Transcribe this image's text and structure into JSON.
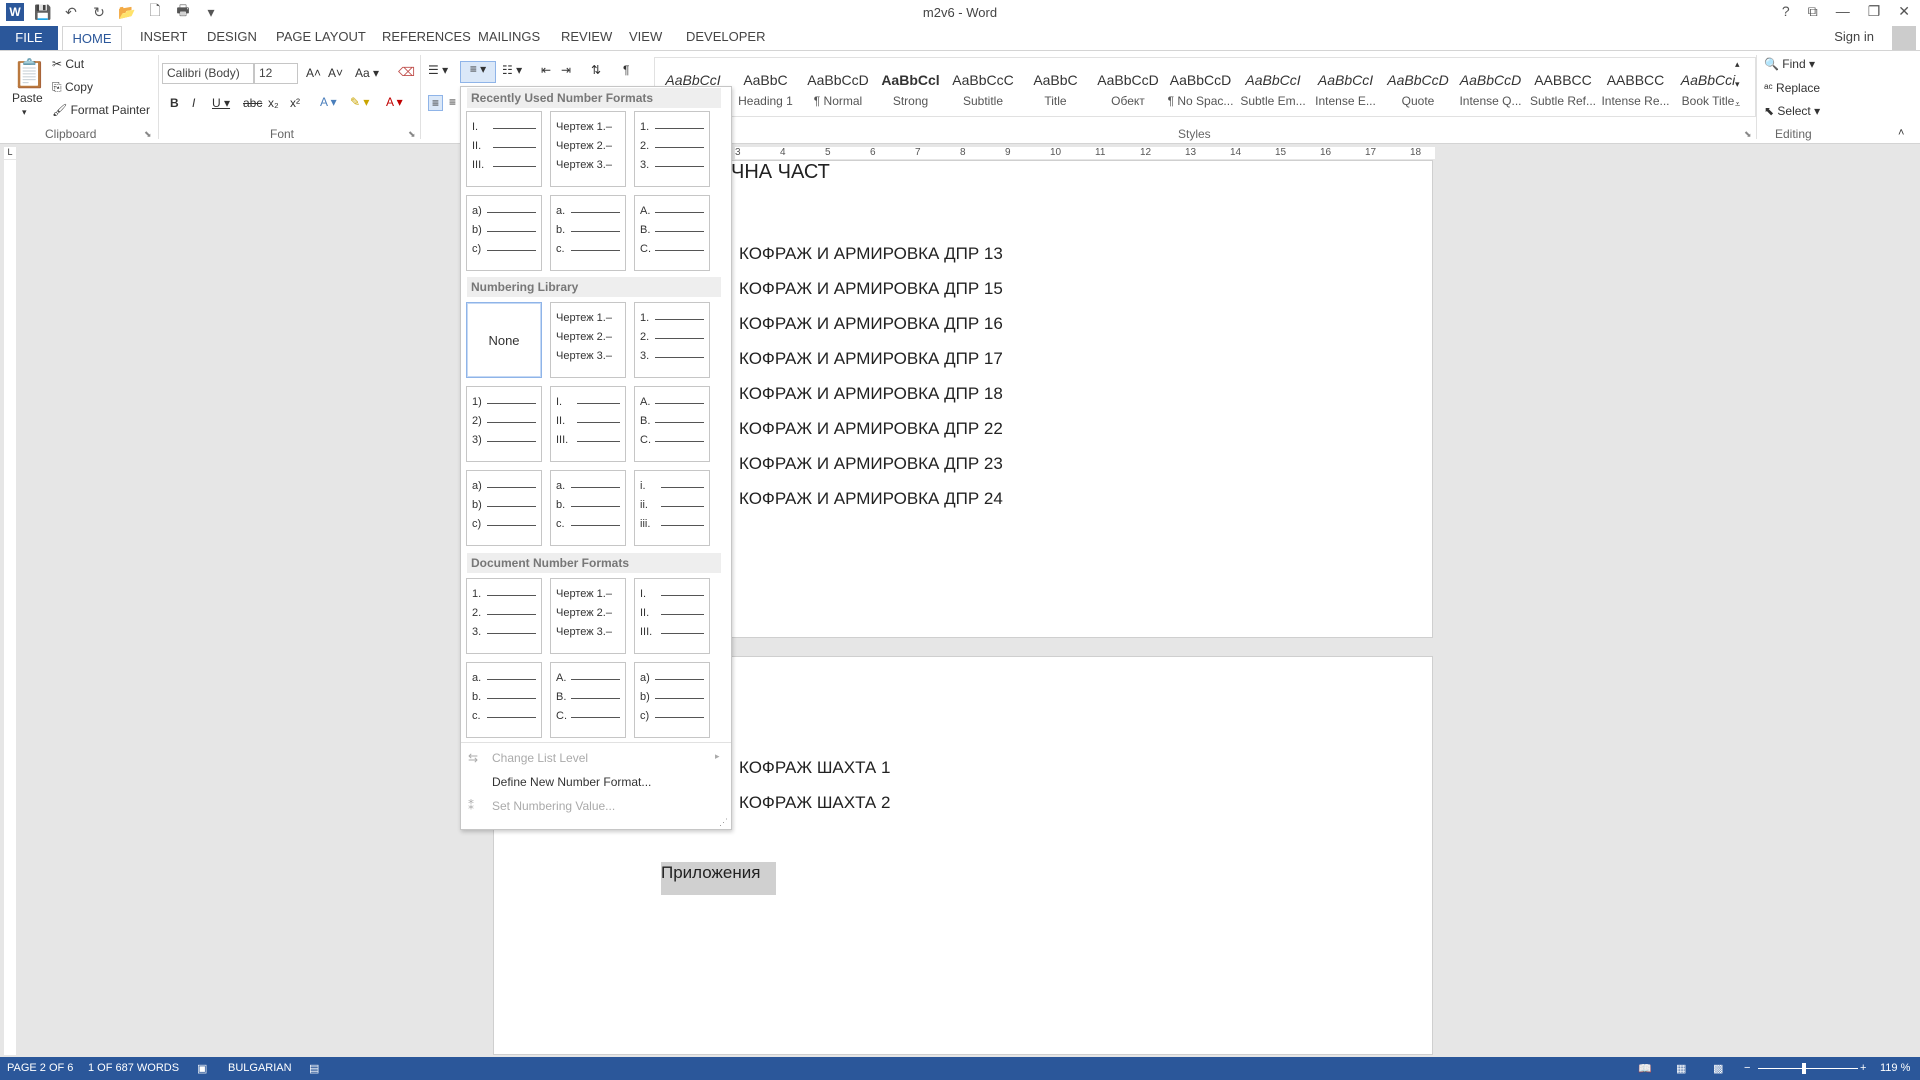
{
  "window": {
    "title": "m2v6 - Word",
    "sign_in": "Sign in"
  },
  "tabs": [
    "FILE",
    "HOME",
    "INSERT",
    "DESIGN",
    "PAGE LAYOUT",
    "REFERENCES",
    "MAILINGS",
    "REVIEW",
    "VIEW",
    "DEVELOPER"
  ],
  "clipboard": {
    "paste": "Paste",
    "cut": "Cut",
    "copy": "Copy",
    "format_painter": "Format Painter",
    "label": "Clipboard"
  },
  "font": {
    "name": "Calibri (Body)",
    "size": "12",
    "case": "Aa",
    "label": "Font"
  },
  "styles": {
    "label": "Styles",
    "items": [
      {
        "sample": "AaBbCcI",
        "name": "",
        "italic": true
      },
      {
        "sample": "AaBbC",
        "name": "Heading 1"
      },
      {
        "sample": "AaBbCcD",
        "name": "¶ Normal"
      },
      {
        "sample": "AaBbCcl",
        "name": "Strong",
        "bold": true
      },
      {
        "sample": "AaBbCcC",
        "name": "Subtitle"
      },
      {
        "sample": "AaBbC",
        "name": "Title"
      },
      {
        "sample": "AaBbCcD",
        "name": "Обект"
      },
      {
        "sample": "AaBbCcD",
        "name": "¶ No Spac..."
      },
      {
        "sample": "AaBbCcI",
        "name": "Subtle Em...",
        "italic": true
      },
      {
        "sample": "AaBbCcI",
        "name": "Intense E...",
        "italic": true
      },
      {
        "sample": "AaBbCcD",
        "name": "Quote",
        "italic": true
      },
      {
        "sample": "AaBbCcD",
        "name": "Intense Q...",
        "italic": true
      },
      {
        "sample": "AABBCC",
        "name": "Subtle Ref..."
      },
      {
        "sample": "AABBCC",
        "name": "Intense Re..."
      },
      {
        "sample": "AaBbCci",
        "name": "Book Title",
        "italic": true
      }
    ]
  },
  "editing": {
    "find": "Find",
    "replace": "Replace",
    "select": "Select",
    "label": "Editing"
  },
  "dropdown": {
    "recent_header": "Recently Used Number Formats",
    "library_header": "Numbering Library",
    "document_header": "Document Number Formats",
    "none_label": "None",
    "change_level": "Change List Level",
    "define_new": "Define New Number Format...",
    "set_value": "Set Numbering Value..."
  },
  "list_formats": {
    "roman": [
      "I.",
      "II.",
      "III."
    ],
    "chertezh": [
      "Чертеж 1.–",
      "Чертеж 2.–",
      "Чертеж 3.–"
    ],
    "arabic": [
      "1.",
      "2.",
      "3."
    ],
    "alpha_paren": [
      "a)",
      "b)",
      "c)"
    ],
    "alpha_lower": [
      "a.",
      "b.",
      "c."
    ],
    "alpha_upper": [
      "A.",
      "B.",
      "C."
    ],
    "arabic_paren": [
      "1)",
      "2)",
      "3)"
    ],
    "roman_lower": [
      "i.",
      "ii.",
      "iii."
    ]
  },
  "document": {
    "heading_fragment": "ЧНА ЧАСТ",
    "lines_page1": [
      "КОФРАЖ И АРМИРОВКА ДПР 13",
      "КОФРАЖ И АРМИРОВКА ДПР 15",
      "КОФРАЖ И АРМИРОВКА ДПР 16",
      "КОФРАЖ И АРМИРОВКА ДПР 17",
      "КОФРАЖ И АРМИРОВКА ДПР 18",
      "КОФРАЖ И АРМИРОВКА ДПР 22",
      "КОФРАЖ И АРМИРОВКА ДПР 23",
      "КОФРАЖ И АРМИРОВКА ДПР 24"
    ],
    "lines_page2": [
      "КОФРАЖ ШАХТА 1",
      "КОФРАЖ ШАХТА 2"
    ],
    "appendix": "Приложения"
  },
  "status": {
    "page": "PAGE 2 OF 6",
    "words": "1 OF 687 WORDS",
    "language": "BULGARIAN",
    "zoom": "119 %"
  },
  "ruler_numbers": [
    "3",
    "4",
    "5",
    "6",
    "7",
    "8",
    "9",
    "10",
    "11",
    "12",
    "13",
    "14",
    "15",
    "16",
    "17",
    "18"
  ]
}
